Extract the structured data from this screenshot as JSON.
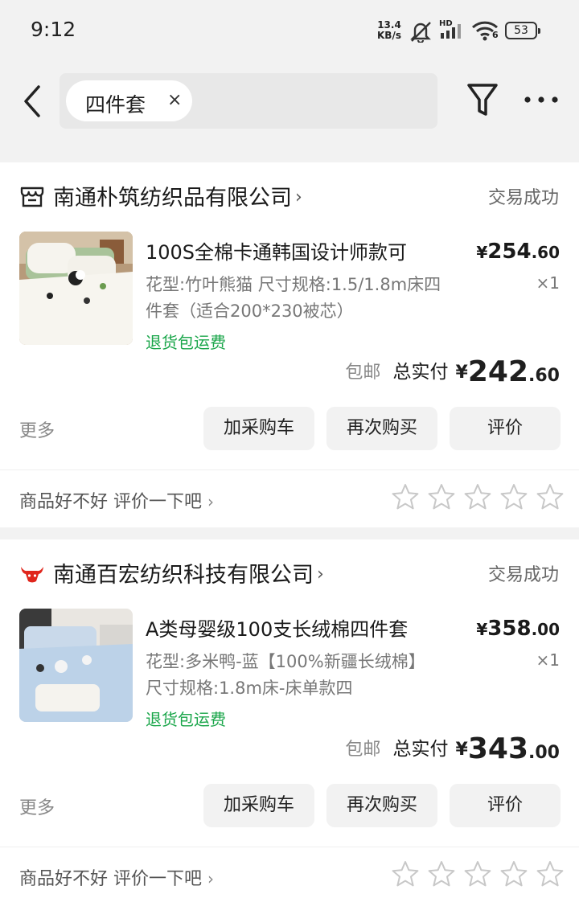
{
  "status_bar": {
    "time": "9:12",
    "net_speed_value": "13.4",
    "net_speed_unit": "KB/s",
    "signal_label": "HD",
    "wifi_label": "6",
    "battery": "53"
  },
  "search": {
    "query_chip": "四件套",
    "clear_glyph": "×"
  },
  "orders": [
    {
      "shop_name": "南通朴筑纺织品有限公司",
      "status": "交易成功",
      "product_title": "100S全棉卡通韩国设计师款可",
      "spec": "花型:竹叶熊猫 尺寸规格:1.5/1.8m床四件套（适合200*230被芯）",
      "return_note": "退货包运费",
      "price_yen": "¥",
      "price_int": "254",
      "price_dec": ".60",
      "qty": "×1",
      "free_ship": "包邮",
      "total_label": "总实付",
      "total_yen": "¥",
      "total_int": "242",
      "total_dec": ".60",
      "more": "更多",
      "buttons": [
        "加采购车",
        "再次购买",
        "评价"
      ],
      "rate_prompt": "商品好不好 评价一下吧",
      "rating_stars": 0
    },
    {
      "shop_name": "南通百宏纺织科技有限公司",
      "status": "交易成功",
      "product_title": "A类母婴级100支长绒棉四件套",
      "spec": "花型:多米鸭-蓝【100%新疆长绒棉】 尺寸规格:1.8m床-床单款四",
      "return_note": "退货包运费",
      "price_yen": "¥",
      "price_int": "358",
      "price_dec": ".00",
      "qty": "×1",
      "free_ship": "包邮",
      "total_label": "总实付",
      "total_yen": "¥",
      "total_int": "343",
      "total_dec": ".00",
      "more": "更多",
      "buttons": [
        "加采购车",
        "再次购买",
        "评价"
      ],
      "rate_prompt": "商品好不好 评价一下吧",
      "rating_stars": 0
    }
  ],
  "colors": {
    "accent_green": "#1aa64a",
    "shop2_logo_red": "#e0261c",
    "page_bg": "#f2f2f2"
  }
}
